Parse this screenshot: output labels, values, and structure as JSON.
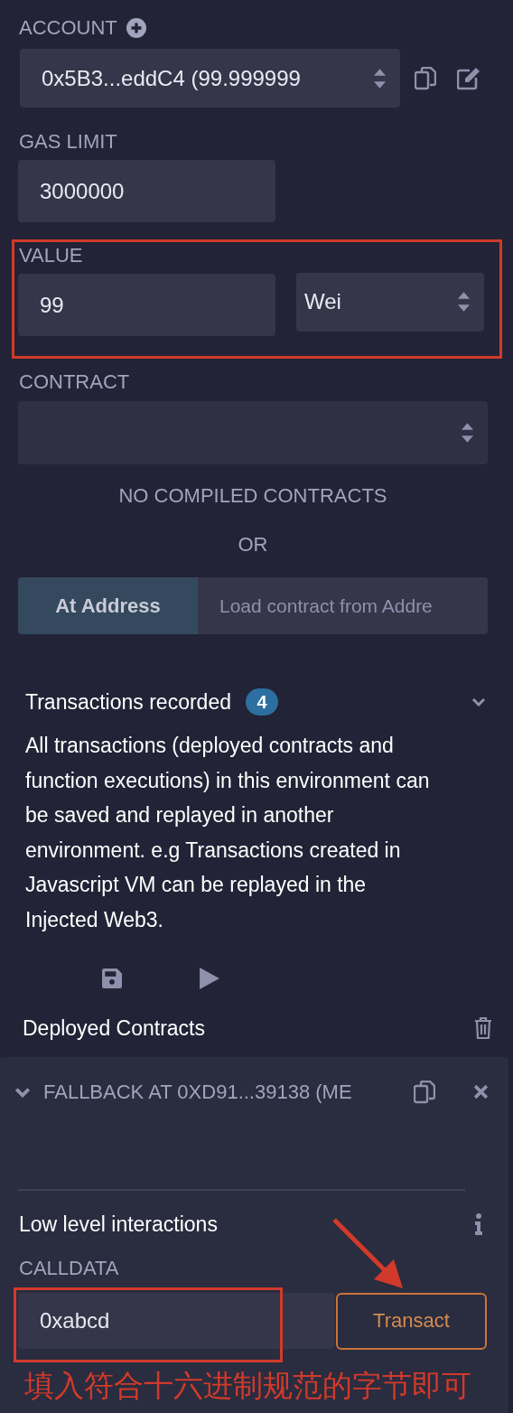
{
  "account": {
    "label": "ACCOUNT",
    "value": "0x5B3...eddC4 (99.999999"
  },
  "gas_limit": {
    "label": "GAS LIMIT",
    "value": "3000000"
  },
  "value": {
    "label": "VALUE",
    "amount": "99",
    "unit": "Wei"
  },
  "contract": {
    "label": "CONTRACT",
    "empty_message": "NO COMPILED CONTRACTS",
    "separator": "OR"
  },
  "at_address": {
    "button": "At Address",
    "placeholder": "Load contract from Addre"
  },
  "transactions": {
    "title": "Transactions recorded",
    "count": "4",
    "description": "All transactions (deployed contracts and function executions) in this environment can be saved and replayed in another environment. e.g Transactions created in Javascript VM can be replayed in the Injected Web3."
  },
  "deployed": {
    "title": "Deployed Contracts",
    "instances": [
      {
        "name": "FALLBACK AT 0XD91...39138 (ME"
      }
    ]
  },
  "low_level": {
    "title": "Low level interactions",
    "calldata_label": "CALLDATA",
    "calldata": "0xabcd",
    "button": "Transact"
  },
  "annotation": {
    "note": "填入符合十六进制规范的字节即可"
  }
}
